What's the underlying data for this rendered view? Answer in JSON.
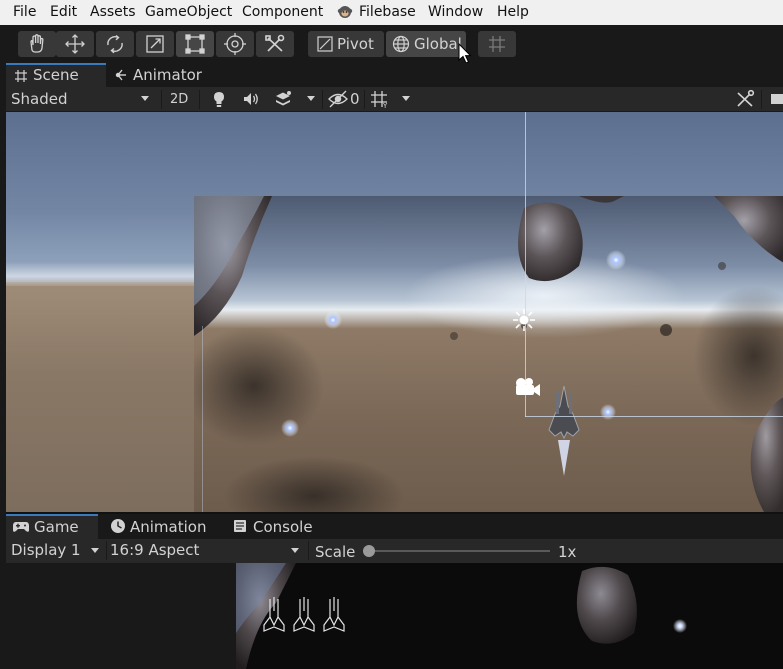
{
  "menu": [
    "File",
    "Edit",
    "Assets",
    "GameObject",
    "Component",
    "Filebase",
    "Window",
    "Help"
  ],
  "toolbar": {
    "tools": [
      "hand-tool",
      "move-tool",
      "rotate-tool",
      "scale-tool",
      "rect-tool",
      "transform-tool",
      "custom-tool"
    ],
    "active_tool": "rect-tool",
    "pivot_label": "Pivot",
    "global_label": "Global"
  },
  "scene_tabs": [
    {
      "label": "Scene",
      "icon": "grid-icon",
      "active": true
    },
    {
      "label": "Animator",
      "icon": "animator-icon",
      "active": false
    }
  ],
  "scene_toolbar": {
    "draw_mode": "Shaded",
    "mode_2d": "2D",
    "hidden_count": "0"
  },
  "game_tabs": [
    {
      "label": "Game",
      "icon": "gamepad-icon",
      "active": true
    },
    {
      "label": "Animation",
      "icon": "clock-icon",
      "active": false
    },
    {
      "label": "Console",
      "icon": "console-icon",
      "active": false
    }
  ],
  "game_toolbar": {
    "display": "Display 1",
    "aspect": "16:9 Aspect",
    "scale_label": "Scale",
    "scale_value": "1x",
    "scale_fraction": 0.0
  },
  "colors": {
    "editor_bg": "#191919",
    "panel_bg": "#282828",
    "button_bg": "#383838",
    "accent_blue": "#3a79bb",
    "menubar_bg": "#f0f0f0"
  }
}
